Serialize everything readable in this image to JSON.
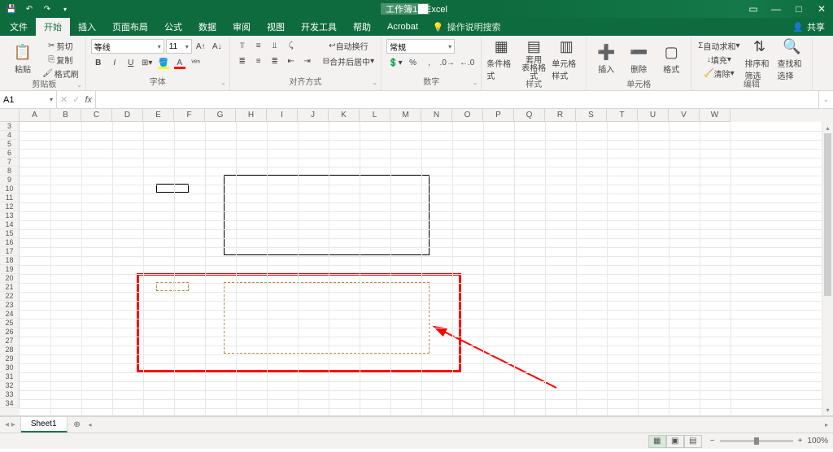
{
  "title": "工作簿1 - Excel",
  "tabs": {
    "file": "文件",
    "home": "开始",
    "insert": "插入",
    "page_layout": "页面布局",
    "formulas": "公式",
    "data": "数据",
    "review": "审阅",
    "view": "视图",
    "developer": "开发工具",
    "help": "帮助",
    "acrobat": "Acrobat"
  },
  "tellme": "操作说明搜索",
  "share": "共享",
  "ribbon": {
    "clipboard": {
      "label": "剪贴板",
      "paste": "粘贴",
      "cut": "剪切",
      "copy": "复制",
      "format_painter": "格式刷"
    },
    "font": {
      "label": "字体",
      "family": "等线",
      "size": "11",
      "bold": "B",
      "italic": "I",
      "underline": "U"
    },
    "alignment": {
      "label": "对齐方式",
      "wrap": "自动换行",
      "merge": "合并后居中"
    },
    "number": {
      "label": "数字",
      "format": "常规"
    },
    "styles": {
      "label": "样式",
      "cond": "条件格式",
      "table": "套用\n表格格式",
      "cell": "单元格样式"
    },
    "cells": {
      "label": "单元格",
      "insert": "插入",
      "delete": "删除",
      "format": "格式"
    },
    "editing": {
      "label": "编辑",
      "autosum": "自动求和",
      "fill": "填充",
      "clear": "清除",
      "sort": "排序和筛选",
      "find": "查找和选择"
    }
  },
  "formula_bar": {
    "name_box": "A1",
    "fx": "fx",
    "value": ""
  },
  "columns": [
    "A",
    "B",
    "C",
    "D",
    "E",
    "F",
    "G",
    "H",
    "I",
    "J",
    "K",
    "L",
    "M",
    "N",
    "O",
    "P",
    "Q",
    "R",
    "S",
    "T",
    "U",
    "V",
    "W"
  ],
  "rows_start": 3,
  "rows_end": 34,
  "sheet": {
    "name": "Sheet1"
  },
  "status": {
    "ready": "",
    "zoom": "100%"
  }
}
